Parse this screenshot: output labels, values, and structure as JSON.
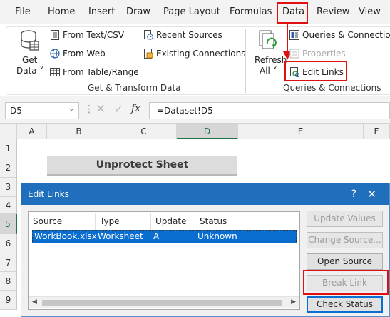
{
  "menu": {
    "items": [
      "File",
      "Home",
      "Insert",
      "Draw",
      "Page Layout",
      "Formulas",
      "Data",
      "Review",
      "View"
    ]
  },
  "ribbon": {
    "get_data": {
      "line1": "Get",
      "line2": "Data ˅"
    },
    "from_text_csv": "From Text/CSV",
    "from_web": "From Web",
    "from_table_range": "From Table/Range",
    "recent_sources": "Recent Sources",
    "existing_connections": "Existing Connections",
    "refresh_all": {
      "line1": "Refresh",
      "line2": "All ˅"
    },
    "queries_connections": "Queries & Connections",
    "properties": "Properties",
    "edit_links": "Edit Links",
    "group_get_transform": "Get & Transform Data",
    "group_queries": "Queries & Connections"
  },
  "formula_bar": {
    "name_box": "D5",
    "fx": "fx",
    "formula": "=Dataset!D5"
  },
  "grid": {
    "columns": [
      "A",
      "B",
      "C",
      "D",
      "E",
      "F"
    ],
    "rows": [
      "1",
      "2",
      "3",
      "4",
      "5",
      "6",
      "7",
      "8",
      "9"
    ],
    "title_cell": "Unprotect Sheet"
  },
  "dialog": {
    "title": "Edit Links",
    "help": "?",
    "close": "✕",
    "headers": [
      "Source",
      "Type",
      "Update",
      "Status"
    ],
    "row": {
      "source": "WorkBook.xlsx",
      "type": "Worksheet",
      "update": "A",
      "status": "Unknown"
    },
    "buttons": {
      "update_values": "Update Values",
      "change_source": "Change Source...",
      "open_source": "Open Source",
      "break_link": "Break Link",
      "check_status": "Check Status"
    }
  },
  "colors": {
    "accent_blue": "#1f6fbd",
    "highlight_red": "#e01010",
    "excel_green": "#217346"
  }
}
